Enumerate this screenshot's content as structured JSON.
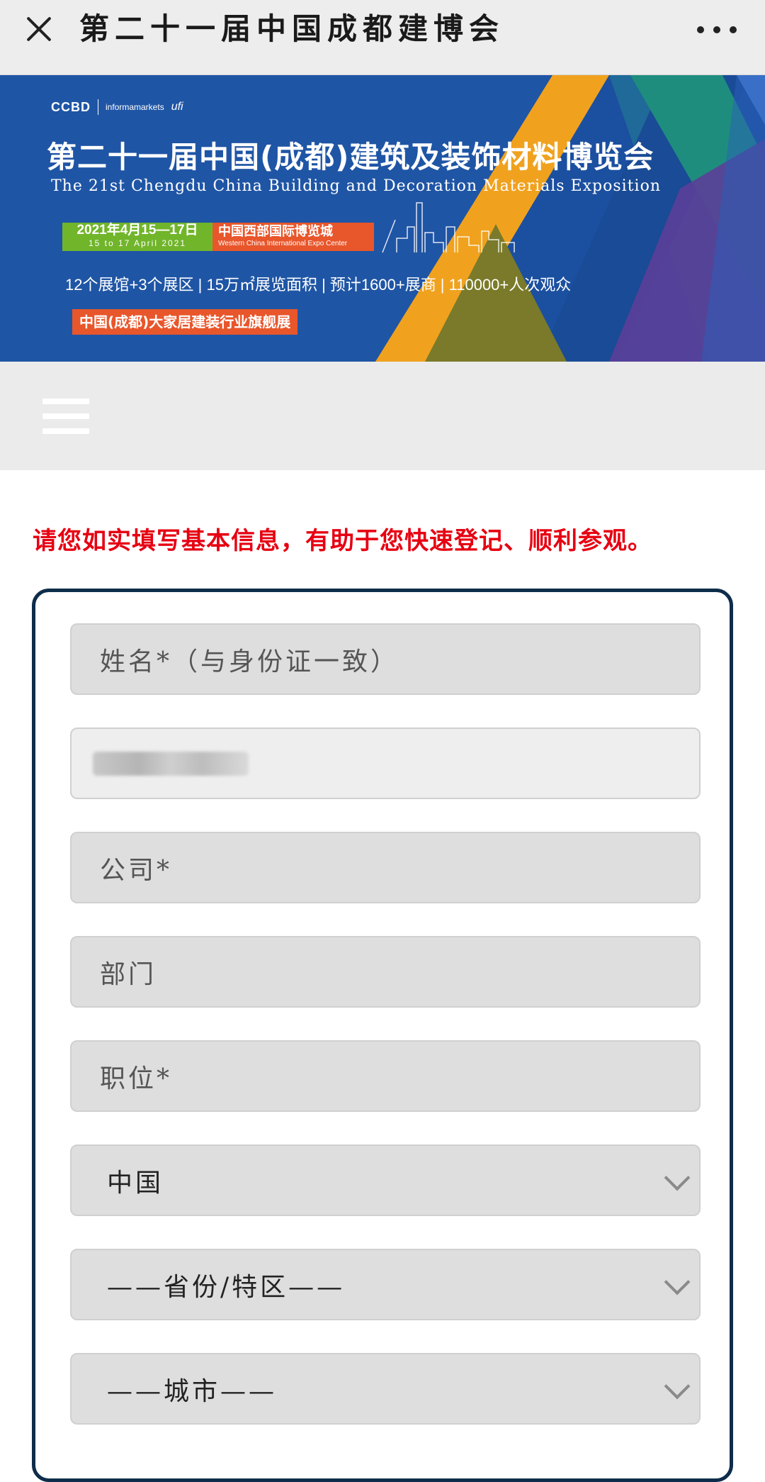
{
  "topbar": {
    "title": "第二十一届中国成都建博会"
  },
  "banner": {
    "brand_ccbd": "CCBD",
    "brand_informa": "informamarkets",
    "brand_ufi": "ufi",
    "title_cn": "第二十一届中国(成都)建筑及装饰材料博览会",
    "title_en": "The 21st Chengdu China Building and Decoration Materials Exposition",
    "date_cn": "2021年4月15—17日",
    "date_en": "15 to 17 April 2021",
    "venue_cn": "中国西部国际博览城",
    "venue_en": "Western China International Expo Center",
    "stats": "12个展馆+3个展区 | 15万㎡展览面积 | 预计1600+展商 | 110000+人次观众",
    "tagline": "中国(成都)大家居建装行业旗舰展"
  },
  "notice": "请您如实填写基本信息，有助于您快速登记、顺利参观。",
  "form": {
    "name_placeholder": "姓名*（与身份证一致）",
    "company_placeholder": "公司*",
    "department_placeholder": "部门",
    "position_placeholder": "职位*",
    "country_value": "中国",
    "province_value": "——省份/特区——",
    "city_value": "——城市——"
  },
  "colors": {
    "notice_red": "#e60012",
    "card_border": "#0e2d4a",
    "banner_blue": "#1f55a5"
  }
}
